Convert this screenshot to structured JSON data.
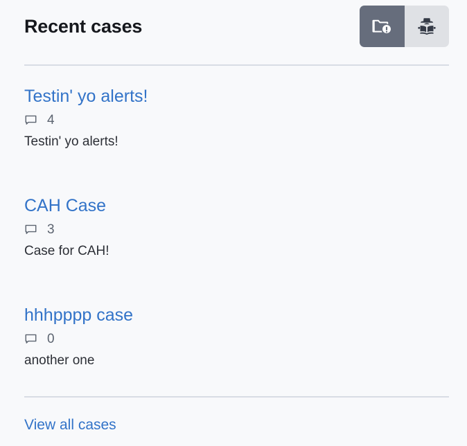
{
  "panel": {
    "title": "Recent cases",
    "accent_color": "#3273c8",
    "background_color": "#f8f9fb",
    "divider_color": "#d8dce4"
  },
  "header_actions": [
    {
      "name": "cases-view-button",
      "icon": "folder-alert-icon",
      "active": true,
      "background_color": "#666d7c",
      "icon_color": "#ffffff"
    },
    {
      "name": "investigate-view-button",
      "icon": "detective-icon",
      "active": false,
      "background_color": "#dfe1e5",
      "icon_color": "#343a46"
    }
  ],
  "cases": [
    {
      "title": "Testin' yo alerts!",
      "comment_icon": "comment-bubble-icon",
      "comment_count": "4",
      "description": "Testin' yo alerts!"
    },
    {
      "title": "CAH Case",
      "comment_icon": "comment-bubble-icon",
      "comment_count": "3",
      "description": "Case for CAH!"
    },
    {
      "title": "hhhpppp case",
      "comment_icon": "comment-bubble-icon",
      "comment_count": "0",
      "description": "another one"
    }
  ],
  "footer": {
    "view_all_label": "View all cases"
  }
}
